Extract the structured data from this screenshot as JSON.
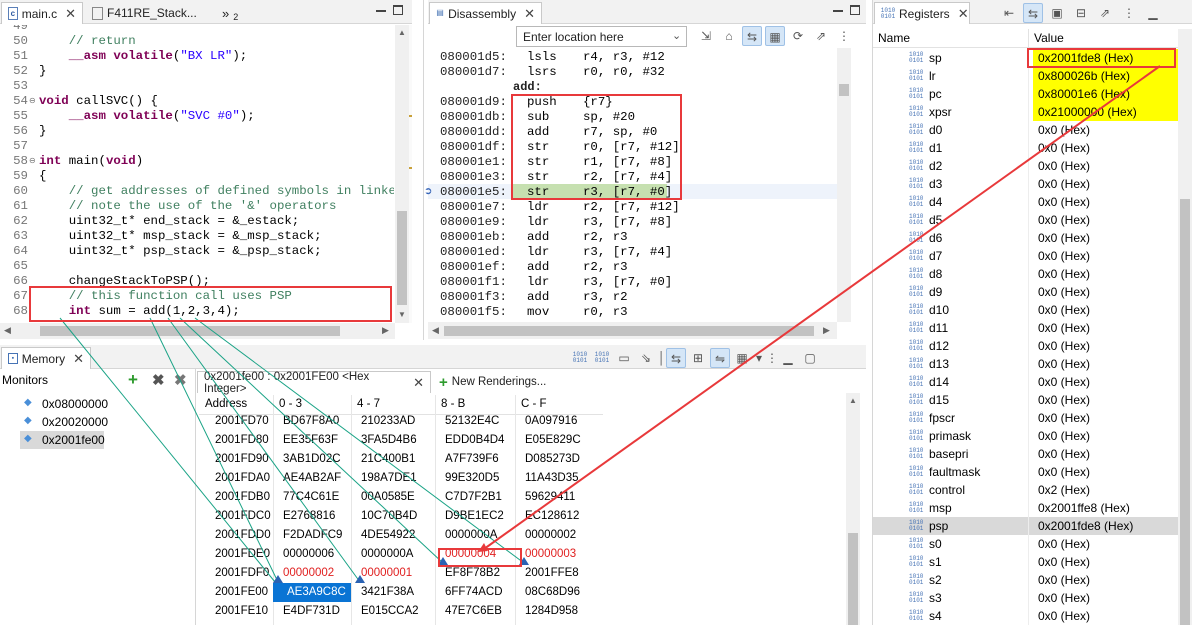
{
  "editor": {
    "tabs": [
      {
        "label": "main.c"
      },
      {
        "label": "F411RE_Stack..."
      },
      {
        "label": "2",
        "overflow_prefix": "»"
      }
    ],
    "lines": [
      {
        "n": "49",
        "text": ""
      },
      {
        "n": "50",
        "text": "    // return"
      },
      {
        "n": "51",
        "text": "    __asm volatile(\"BX LR\");"
      },
      {
        "n": "52",
        "text": "}"
      },
      {
        "n": "53",
        "text": ""
      },
      {
        "n": "54",
        "text": "void callSVC() {"
      },
      {
        "n": "55",
        "text": "    __asm volatile(\"SVC #0\");"
      },
      {
        "n": "56",
        "text": "}"
      },
      {
        "n": "57",
        "text": ""
      },
      {
        "n": "58",
        "text": "int main(void)"
      },
      {
        "n": "59",
        "text": "{"
      },
      {
        "n": "60",
        "text": "    // get addresses of defined symbols in linker scr"
      },
      {
        "n": "61",
        "text": "    // note the use of the '&' operators"
      },
      {
        "n": "62",
        "text": "    uint32_t* end_stack = &_estack;"
      },
      {
        "n": "63",
        "text": "    uint32_t* msp_stack = &_msp_stack;"
      },
      {
        "n": "64",
        "text": "    uint32_t* psp_stack = &_psp_stack;"
      },
      {
        "n": "65",
        "text": ""
      },
      {
        "n": "66",
        "text": "    changeStackToPSP();"
      },
      {
        "n": "67",
        "text": "    // this function call uses PSP"
      },
      {
        "n": "68",
        "text": "    int sum = add(1,2,3,4);"
      }
    ]
  },
  "disassembly": {
    "title": "Disassembly",
    "location_placeholder": "Enter location here",
    "label": "add:",
    "rows_top": [
      {
        "addr": "080001d5:",
        "op": "lsls",
        "arg": "r4, r3, #12"
      },
      {
        "addr": "080001d7:",
        "op": "lsrs",
        "arg": "r0, r0, #32"
      }
    ],
    "rows": [
      {
        "addr": "080001d9:",
        "op": "push",
        "arg": "{r7}"
      },
      {
        "addr": "080001db:",
        "op": "sub",
        "arg": "sp, #20"
      },
      {
        "addr": "080001dd:",
        "op": "add",
        "arg": "r7, sp, #0"
      },
      {
        "addr": "080001df:",
        "op": "str",
        "arg": "r0, [r7, #12]"
      },
      {
        "addr": "080001e1:",
        "op": "str",
        "arg": "r1, [r7, #8]"
      },
      {
        "addr": "080001e3:",
        "op": "str",
        "arg": "r2, [r7, #4]"
      },
      {
        "addr": "080001e5:",
        "op": "str",
        "arg": "r3, [r7, #0]"
      },
      {
        "addr": "080001e7:",
        "op": "ldr",
        "arg": "r2, [r7, #12]"
      },
      {
        "addr": "080001e9:",
        "op": "ldr",
        "arg": "r3, [r7, #8]"
      },
      {
        "addr": "080001eb:",
        "op": "add",
        "arg": "r2, r3"
      },
      {
        "addr": "080001ed:",
        "op": "ldr",
        "arg": "r3, [r7, #4]"
      },
      {
        "addr": "080001ef:",
        "op": "add",
        "arg": "r2, r3"
      },
      {
        "addr": "080001f1:",
        "op": "ldr",
        "arg": "r3, [r7, #0]"
      },
      {
        "addr": "080001f3:",
        "op": "add",
        "arg": "r3, r2"
      },
      {
        "addr": "080001f5:",
        "op": "mov",
        "arg": "r0, r3"
      }
    ]
  },
  "registers": {
    "title": "Registers",
    "col_name": "Name",
    "col_value": "Value",
    "icon_text": "1010 0101",
    "highlight_color": "#ffff00",
    "rows": [
      {
        "name": "sp",
        "value": "0x2001fde8 (Hex)",
        "hl": true
      },
      {
        "name": "lr",
        "value": "0x800026b (Hex)",
        "hl": true
      },
      {
        "name": "pc",
        "value": "0x80001e6 (Hex)",
        "hl": true
      },
      {
        "name": "xpsr",
        "value": "0x21000000 (Hex)",
        "hl": true
      },
      {
        "name": "d0",
        "value": "0x0 (Hex)"
      },
      {
        "name": "d1",
        "value": "0x0 (Hex)"
      },
      {
        "name": "d2",
        "value": "0x0 (Hex)"
      },
      {
        "name": "d3",
        "value": "0x0 (Hex)"
      },
      {
        "name": "d4",
        "value": "0x0 (Hex)"
      },
      {
        "name": "d5",
        "value": "0x0 (Hex)"
      },
      {
        "name": "d6",
        "value": "0x0 (Hex)"
      },
      {
        "name": "d7",
        "value": "0x0 (Hex)"
      },
      {
        "name": "d8",
        "value": "0x0 (Hex)"
      },
      {
        "name": "d9",
        "value": "0x0 (Hex)"
      },
      {
        "name": "d10",
        "value": "0x0 (Hex)"
      },
      {
        "name": "d11",
        "value": "0x0 (Hex)"
      },
      {
        "name": "d12",
        "value": "0x0 (Hex)"
      },
      {
        "name": "d13",
        "value": "0x0 (Hex)"
      },
      {
        "name": "d14",
        "value": "0x0 (Hex)"
      },
      {
        "name": "d15",
        "value": "0x0 (Hex)"
      },
      {
        "name": "fpscr",
        "value": "0x0 (Hex)"
      },
      {
        "name": "primask",
        "value": "0x0 (Hex)"
      },
      {
        "name": "basepri",
        "value": "0x0 (Hex)"
      },
      {
        "name": "faultmask",
        "value": "0x0 (Hex)"
      },
      {
        "name": "control",
        "value": "0x2 (Hex)"
      },
      {
        "name": "msp",
        "value": "0x2001ffe8 (Hex)"
      },
      {
        "name": "psp",
        "value": "0x2001fde8 (Hex)",
        "selected": true
      },
      {
        "name": "s0",
        "value": "0x0 (Hex)"
      },
      {
        "name": "s1",
        "value": "0x0 (Hex)"
      },
      {
        "name": "s2",
        "value": "0x0 (Hex)"
      },
      {
        "name": "s3",
        "value": "0x0 (Hex)"
      },
      {
        "name": "s4",
        "value": "0x0 (Hex)"
      }
    ]
  },
  "memory": {
    "title": "Memory",
    "monitors_label": "Monitors",
    "monitors": [
      "0x08000000",
      "0x20020000",
      "0x2001fe00"
    ],
    "rendering_tab": "0x2001fe00 : 0x2001FE00 <Hex Integer>",
    "new_renderings": "New Renderings...",
    "columns": [
      "Address",
      "0 - 3",
      "4 - 7",
      "8 - B",
      "C - F"
    ],
    "rows": [
      {
        "addr": "2001FD70",
        "c": [
          "BD67F8A0",
          "210233AD",
          "52132E4C",
          "0A097916"
        ]
      },
      {
        "addr": "2001FD80",
        "c": [
          "EE35F63F",
          "3FA5D4B6",
          "EDD0B4D4",
          "E05E829C"
        ]
      },
      {
        "addr": "2001FD90",
        "c": [
          "3AB1D02C",
          "21C400B1",
          "A7F739F6",
          "D085273D"
        ]
      },
      {
        "addr": "2001FDA0",
        "c": [
          "AE4AB2AF",
          "198A7DE1",
          "99E320D5",
          "11A43D35"
        ]
      },
      {
        "addr": "2001FDB0",
        "c": [
          "77C4C61E",
          "00A0585E",
          "C7D7F2B1",
          "59629411"
        ]
      },
      {
        "addr": "2001FDC0",
        "c": [
          "E2768816",
          "10C70B4D",
          "D9BE1EC2",
          "EC128612"
        ]
      },
      {
        "addr": "2001FDD0",
        "c": [
          "F2DADFC9",
          "4DE54922",
          "0000000A",
          "00000002"
        ]
      },
      {
        "addr": "2001FDE0",
        "c": [
          "00000006",
          "0000000A",
          "00000004",
          "00000003"
        ],
        "red": [
          2,
          3
        ]
      },
      {
        "addr": "2001FDF0",
        "c": [
          "00000002",
          "00000001",
          "EF8F78B2",
          "2001FFE8"
        ],
        "red": [
          0,
          1
        ]
      },
      {
        "addr": "2001FE00",
        "c": [
          "AE3A9C8C",
          "3421F38A",
          "6FF74ACD",
          "08C68D96"
        ],
        "sel": 0
      },
      {
        "addr": "2001FE10",
        "c": [
          "E4DF731D",
          "E015CCA2",
          "47E7C6EB",
          "1284D958"
        ]
      }
    ]
  },
  "colors": {
    "annotation_red": "#e8393b",
    "connector_teal": "#1aa386",
    "current_line_green": "#c6e0b0",
    "selection_blue": "#0a74d4"
  }
}
